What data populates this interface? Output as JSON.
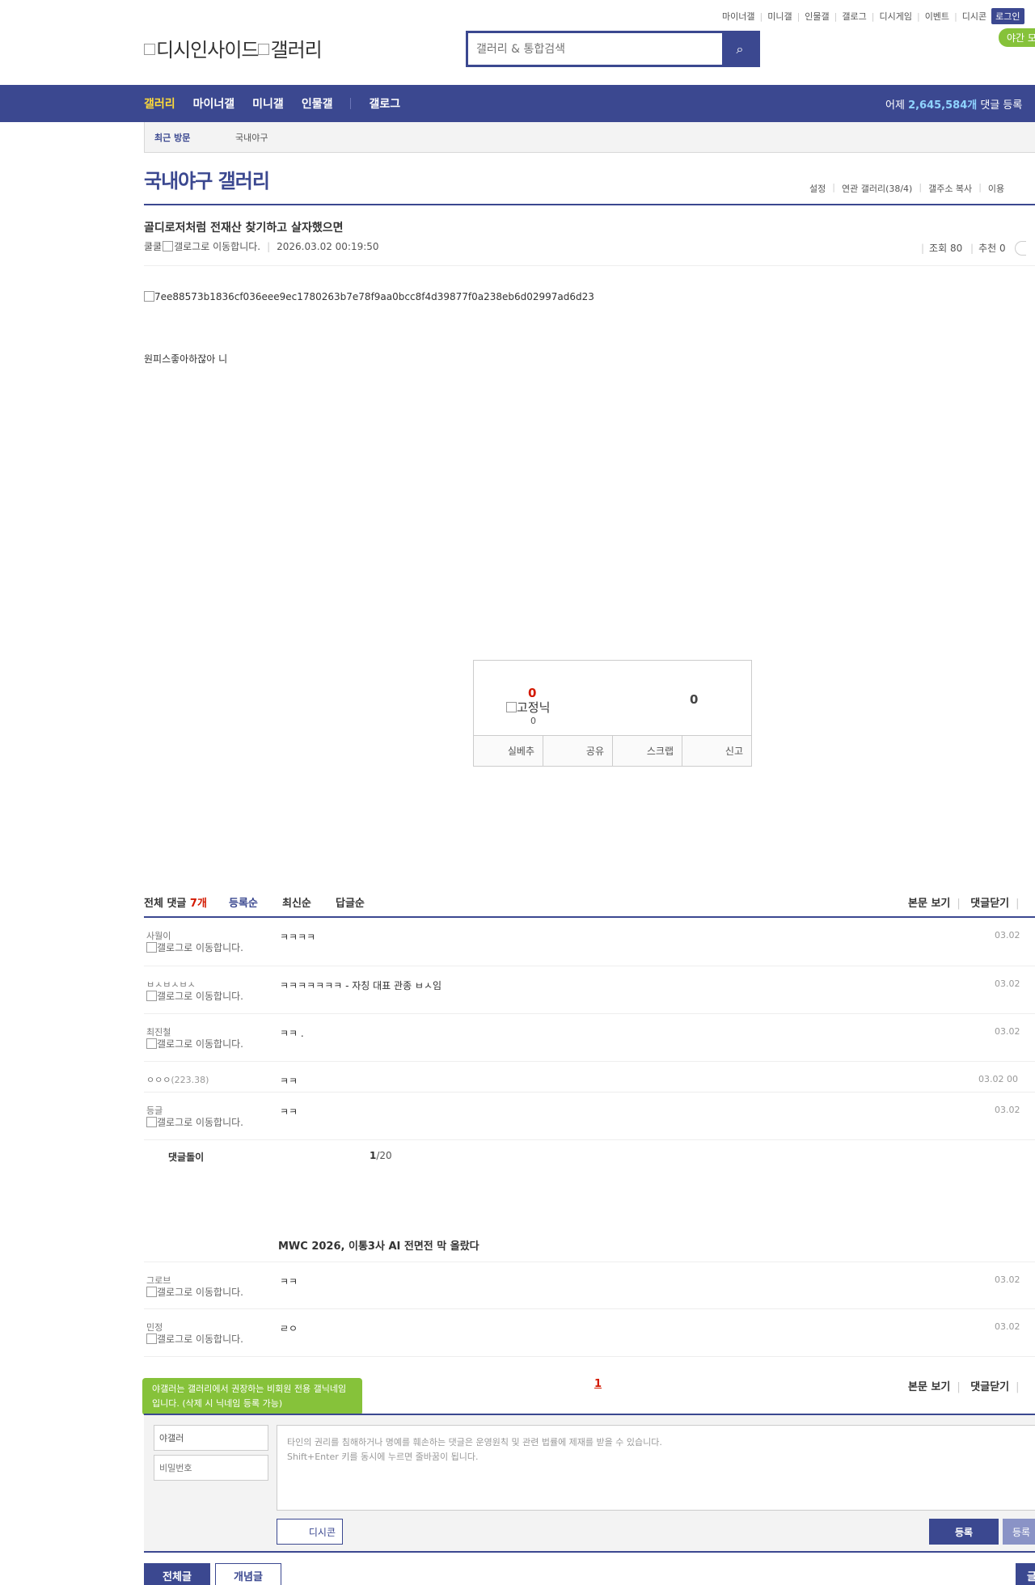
{
  "header": {
    "top_menu": [
      "마이너갤",
      "미니갤",
      "인물갤",
      "갤로그",
      "디시게임",
      "이벤트",
      "디시콘"
    ],
    "login_label": "로그인",
    "night_mode_label": "야간 모",
    "logo_alt_1": "디시인사이드",
    "logo_alt_2": "갤러리",
    "search_placeholder": "갤러리 & 통합검색"
  },
  "gnb": {
    "items": [
      "갤러리",
      "마이너갤",
      "미니갤",
      "인물갤",
      "갤로그"
    ],
    "stat_prefix": "어제",
    "stat_value": "2,645,584개",
    "stat_suffix": "댓글 등록"
  },
  "recent_visit": {
    "label": "최근 방문",
    "gallery": "국내야구"
  },
  "gallery": {
    "title": "국내야구 갤러리",
    "tools": [
      "설정",
      "연관 갤러리(38/4)",
      "갤주소 복사",
      "이용"
    ]
  },
  "post": {
    "title": "골디로저처럼 전재산 찾기하고 살자했으면",
    "author": "쿨쿨",
    "gallog_alt": "갤로그로 이동합니다.",
    "date": "2026.03.02 00:19:50",
    "views_label": "조회 80",
    "recommend_label": "추천 0",
    "image_alt": "7ee88573b1836cf036eee9ec1780263b7e78f9aa0bcc8f4d39877f0a238eb6d02997ad6d23",
    "body": "원피스좋아하잖아 니"
  },
  "recommend_box": {
    "up_count": "0",
    "fixed_nick_alt": "고정닉",
    "fixed_count": "0",
    "down_count": "0",
    "buttons": [
      "실베추",
      "공유",
      "스크랩",
      "신고"
    ]
  },
  "comments_header": {
    "total_label": "전체 댓글",
    "total_count": "7개",
    "sort_tabs": [
      "등록순",
      "최신순",
      "답글순"
    ],
    "right_actions": [
      "본문 보기",
      "댓글닫기"
    ]
  },
  "comments": [
    {
      "nick": "사월이",
      "gallog_alt": "갤로그로 이동합니다.",
      "text": "ㅋㅋㅋㅋ",
      "date": "03.02"
    },
    {
      "nick": "ㅂㅅㅂㅅㅂㅅ",
      "gallog_alt": "갤로그로 이동합니다.",
      "text": "ㅋㅋㅋㅋㅋㅋㅋ - 자칭 대표 관종 ㅂㅅ임",
      "date": "03.02"
    },
    {
      "nick": "최진철",
      "gallog_alt": "갤로그로 이동합니다.",
      "text": "ㅋㅋ .",
      "date": "03.02"
    },
    {
      "nick": "ㅇㅇㅇ",
      "ip": "(223.38)",
      "text": "ㅋㅋ",
      "date": "03.02 00"
    },
    {
      "nick": "등글",
      "gallog_alt": "갤로그로 이동합니다.",
      "text": "ㅋㅋ",
      "date": "03.02"
    }
  ],
  "dory": {
    "label": "댓글돌이",
    "page_current": "1",
    "page_total": "/20"
  },
  "news_title": "MWC 2026, 이통3사 AI 전면전 막 올랐다",
  "comments_more": [
    {
      "nick": "그로브",
      "gallog_alt": "갤로그로 이동합니다.",
      "text": "ㅋㅋ",
      "date": "03.02"
    },
    {
      "nick": "민정",
      "gallog_alt": "갤로그로 이동합니다.",
      "text": "ㄹㅇ",
      "date": "03.02"
    }
  ],
  "comments_footer": {
    "page": "1",
    "right_actions": [
      "본문 보기",
      "댓글닫기"
    ]
  },
  "write": {
    "tooltip": "야갤러는 갤러리에서 권장하는 비회원 전용 갤닉네임입니다. (삭제 시 닉네임 등록 가능)",
    "nick_value": "야갤러",
    "password_placeholder": "비밀번호",
    "textarea_line1": "타인의 권리를 침해하거나 명예를 훼손하는 댓글은 운영원칙 및 관련 법률에 제재를 받을 수 있습니다.",
    "textarea_line2": "Shift+Enter 키를 동시에 누르면 줄바꿈이 됩니다.",
    "dccon_label": "디시콘",
    "submit_label": "등록",
    "submit2_label": "등록"
  },
  "bottom": {
    "all_label": "전체글",
    "concept_label": "개념글",
    "write_label": "글"
  }
}
